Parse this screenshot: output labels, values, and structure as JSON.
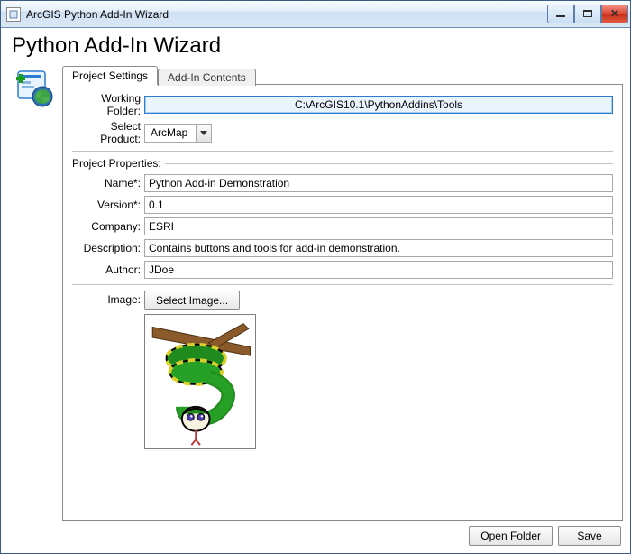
{
  "window": {
    "title": "ArcGIS Python Add-In Wizard"
  },
  "heading": "Python Add-In Wizard",
  "tabs": {
    "project_settings": "Project Settings",
    "addin_contents": "Add-In Contents"
  },
  "labels": {
    "working_folder": "Working Folder:",
    "select_product": "Select Product:",
    "project_properties": "Project Properties:",
    "name": "Name*:",
    "version": "Version*:",
    "company": "Company:",
    "description": "Description:",
    "author": "Author:",
    "image": "Image:"
  },
  "values": {
    "working_folder": "C:\\ArcGIS10.1\\PythonAddins\\Tools",
    "product": "ArcMap",
    "name": "Python Add-in Demonstration",
    "version": "0.1",
    "company": "ESRI",
    "description": "Contains buttons and tools for add-in demonstration.",
    "author": "JDoe"
  },
  "buttons": {
    "select_image": "Select Image...",
    "open_folder": "Open Folder",
    "save": "Save"
  },
  "icons": {
    "app": "app-icon",
    "wizard": "wizard-addin-icon",
    "dropdown": "chevron-down-icon",
    "preview": "python-snake-image"
  }
}
